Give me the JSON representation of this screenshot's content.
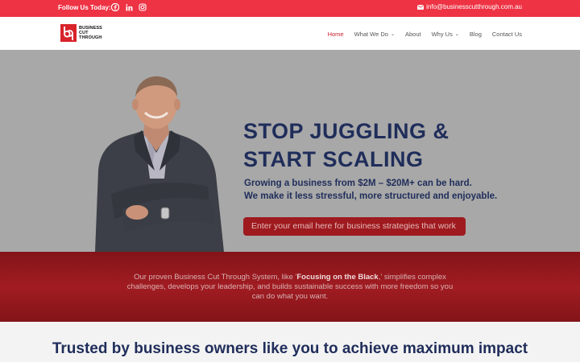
{
  "topbar": {
    "follow_label": "Follow Us Today:",
    "social": [
      {
        "icon": "facebook-icon"
      },
      {
        "icon": "linkedin-icon"
      },
      {
        "icon": "instagram-icon"
      }
    ],
    "email": "info@businesscutthrough.com.au",
    "bg_color": "#ee3344"
  },
  "header": {
    "logo_lines": [
      "BUSINESS",
      "CUT",
      "THROUGH"
    ],
    "nav": [
      {
        "label": "Home",
        "active": true
      },
      {
        "label": "What We Do",
        "dropdown": true
      },
      {
        "label": "About"
      },
      {
        "label": "Why Us",
        "dropdown": true
      },
      {
        "label": "Blog"
      },
      {
        "label": "Contact Us"
      }
    ],
    "active_color": "#cc2233"
  },
  "hero": {
    "headline_line1": "STOP JUGGLING &",
    "headline_line2": "START SCALING",
    "sub_line1": "Growing a business from $2M – $20M+ can be hard.",
    "sub_line2": "We make it less stressful, more structured and enjoyable.",
    "cta_placeholder": "Enter your email here for business strategies that work",
    "headline_color": "#1f2d5a"
  },
  "band": {
    "text_before": "Our proven Business Cut Through System, like '",
    "text_bold": "Focusing on the Black",
    "text_after": ",' simplifies complex challenges, develops your leadership, and builds sustainable success with more freedom so you can do what you want."
  },
  "trusted": {
    "heading": "Trusted by business owners like you to achieve maximum impact"
  }
}
